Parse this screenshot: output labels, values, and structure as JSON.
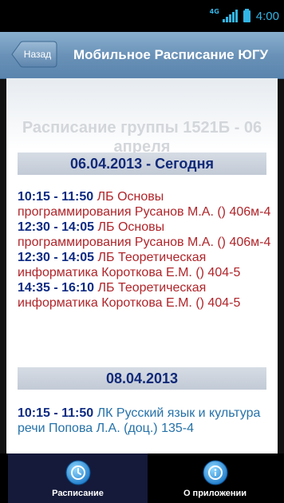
{
  "status_bar": {
    "network": "4G",
    "time": "4:00",
    "icons": [
      "signal-icon",
      "battery-icon"
    ],
    "accent_color": "#33b5e5"
  },
  "header": {
    "back_label": "Назад",
    "title": "Мобильное Расписание ЮГУ"
  },
  "schedule": {
    "title": "Расписание группы 1521Б - 06 апреля",
    "days": [
      {
        "date": "06.04.2013 - Сегодня",
        "lessons": [
          {
            "time": "10:15 - 11:50",
            "text": "ЛБ Основы программирования Русанов М.А. () 406м-4"
          },
          {
            "time": "12:30 - 14:05",
            "text": "ЛБ Основы программирования Русанов М.А. () 406м-4"
          },
          {
            "time": "12:30 - 14:05",
            "text": "ЛБ Теоретическая информатика Короткова Е.М. () 404-5"
          },
          {
            "time": "14:35 - 16:10",
            "text": "ЛБ Теоретическая информатика Короткова Е.М. () 404-5"
          }
        ]
      },
      {
        "date": "08.04.2013",
        "lessons": [
          {
            "time": "10:15 - 11:50",
            "text": "ЛК Русский язык и культура речи Попова Л.А. (доц.) 135-4"
          }
        ]
      }
    ]
  },
  "tabs": [
    {
      "label": "Расписание",
      "icon": "clock-icon",
      "selected": true
    },
    {
      "label": "О приложении",
      "icon": "info-icon",
      "selected": false
    }
  ],
  "colors": {
    "time_text": "#0d2a82",
    "lab_text": "#b0252a",
    "lecture_text": "#2572a9",
    "date_text": "#112a78"
  }
}
